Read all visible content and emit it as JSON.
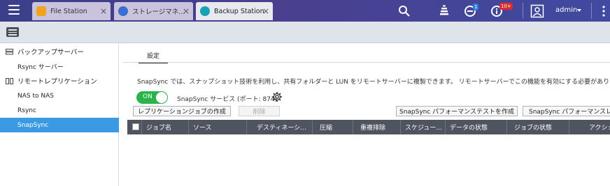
{
  "topbar": {
    "tabs": [
      {
        "label": "File Station",
        "icon": "file-station-icon",
        "active": false
      },
      {
        "label": "ストレージマネ...",
        "icon": "storage-manager-icon",
        "active": false
      },
      {
        "label": "Backup Station",
        "icon": "backup-station-icon",
        "active": true
      }
    ],
    "badges": {
      "notifications": "1",
      "alerts": "10+"
    },
    "user": "admin",
    "colors": {
      "bar": "#3f4190",
      "badge_blue": "#2f7de1",
      "badge_red": "#e02a2a"
    }
  },
  "sidebar": {
    "sections": [
      {
        "label": "バックアップサーバー",
        "items": [
          "Rsync サーバー"
        ]
      },
      {
        "label": "リモートレプリケーション",
        "items": [
          "NAS to NAS",
          "Rsync",
          "SnapSync"
        ]
      }
    ],
    "active_item": "SnapSync",
    "active_color": "#3a9be3"
  },
  "main": {
    "tab": "設定",
    "description": "SnapSync では、スナップショット技術を利用し、共有フォルダーと LUN をリモートサーバーに複製できます。 リモートサーバーでこの機能を有効にする必要があります。",
    "toggle": {
      "label": "ON",
      "state": true
    },
    "service_label": "SnapSync サービス (ポート: 874)",
    "buttons": {
      "create_job": "レプリケーションジョブの作成",
      "delete": "削除",
      "perf_test": "SnapSync パフォーマンステストを作成",
      "perf_report": "SnapSync パフォーマンスレポ"
    },
    "table": {
      "columns": [
        "ジョブ名",
        "ソース",
        "デスティネーシ...",
        "圧縮",
        "重複排除",
        "スケジュー...",
        "データの状態",
        "ジョブの状態",
        "アクショ"
      ]
    }
  }
}
